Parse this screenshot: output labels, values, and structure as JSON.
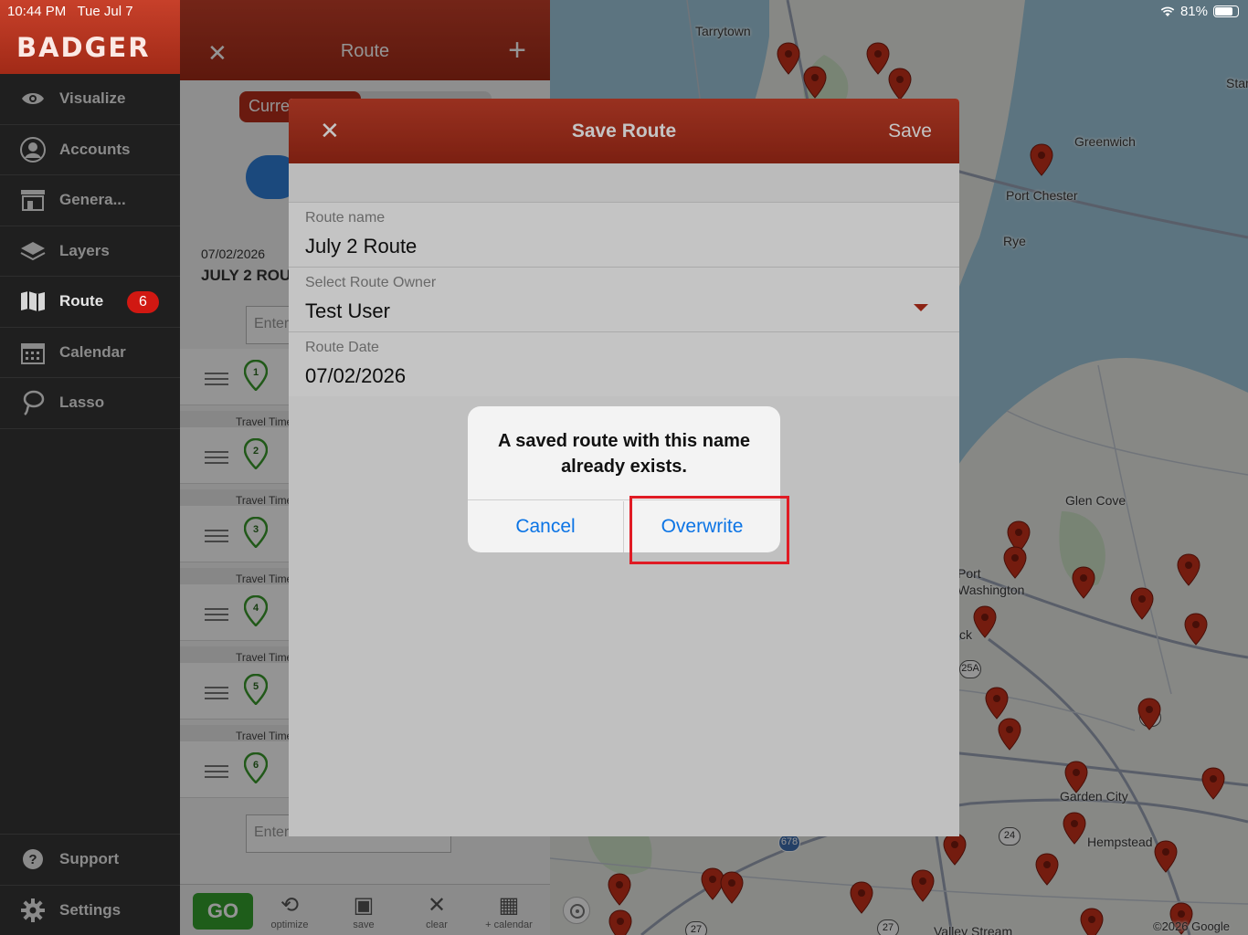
{
  "status_bar": {
    "time": "10:44 PM",
    "date": "Tue Jul 7",
    "battery": "81%",
    "wifi_icon": "wifi-icon"
  },
  "sidebar": {
    "brand": "BADGER",
    "items": [
      {
        "label": "Visualize",
        "icon": "eye-icon"
      },
      {
        "label": "Accounts",
        "icon": "person-icon"
      },
      {
        "label": "Genera...",
        "icon": "store-icon"
      },
      {
        "label": "Layers",
        "icon": "layers-icon"
      },
      {
        "label": "Route",
        "icon": "map-icon",
        "badge": "6",
        "active": true
      },
      {
        "label": "Calendar",
        "icon": "calendar-icon"
      },
      {
        "label": "Lasso",
        "icon": "lasso-icon"
      }
    ],
    "bottom_items": [
      {
        "label": "Support",
        "icon": "help-icon"
      },
      {
        "label": "Settings",
        "icon": "gear-icon"
      }
    ]
  },
  "route_panel": {
    "title": "Route",
    "tab_current": "Curre",
    "route_date": "07/02/2026",
    "route_name": "JULY 2 ROU",
    "enter_placeholder": "Enter",
    "enter_location_placeholder": "Enter Location",
    "stops": [
      "1",
      "2",
      "3",
      "4",
      "5",
      "6"
    ],
    "travel_label": "Travel Time",
    "toolbar": {
      "go": "GO",
      "optimize": "optimize",
      "save": "save",
      "clear": "clear",
      "calendar": "+ calendar"
    }
  },
  "save_route_modal": {
    "title": "Save Route",
    "save_label": "Save",
    "route_name_label": "Route name",
    "route_name_value": "July 2 Route",
    "owner_label": "Select Route Owner",
    "owner_value": "Test User",
    "date_label": "Route Date",
    "date_value": "07/02/2026"
  },
  "alert": {
    "message": "A saved route with this name already exists.",
    "cancel": "Cancel",
    "overwrite": "Overwrite"
  },
  "map": {
    "places": [
      "Tarrytown",
      "Star",
      "Greenwich",
      "Port Chester",
      "Rye",
      "Glen Cove",
      "Port Washington",
      "ck",
      "Garden City",
      "Hempstead",
      "Valley Stream"
    ],
    "highways": [
      "25A",
      "25",
      "24",
      "678",
      "27",
      "27"
    ],
    "copyright": "©2026 Google"
  },
  "colors": {
    "brand_red": "#b72e1a",
    "pin_red": "#c8311b",
    "alert_blue": "#0b74e5",
    "highlight": "#e01b24",
    "go_green": "#34a02e"
  }
}
